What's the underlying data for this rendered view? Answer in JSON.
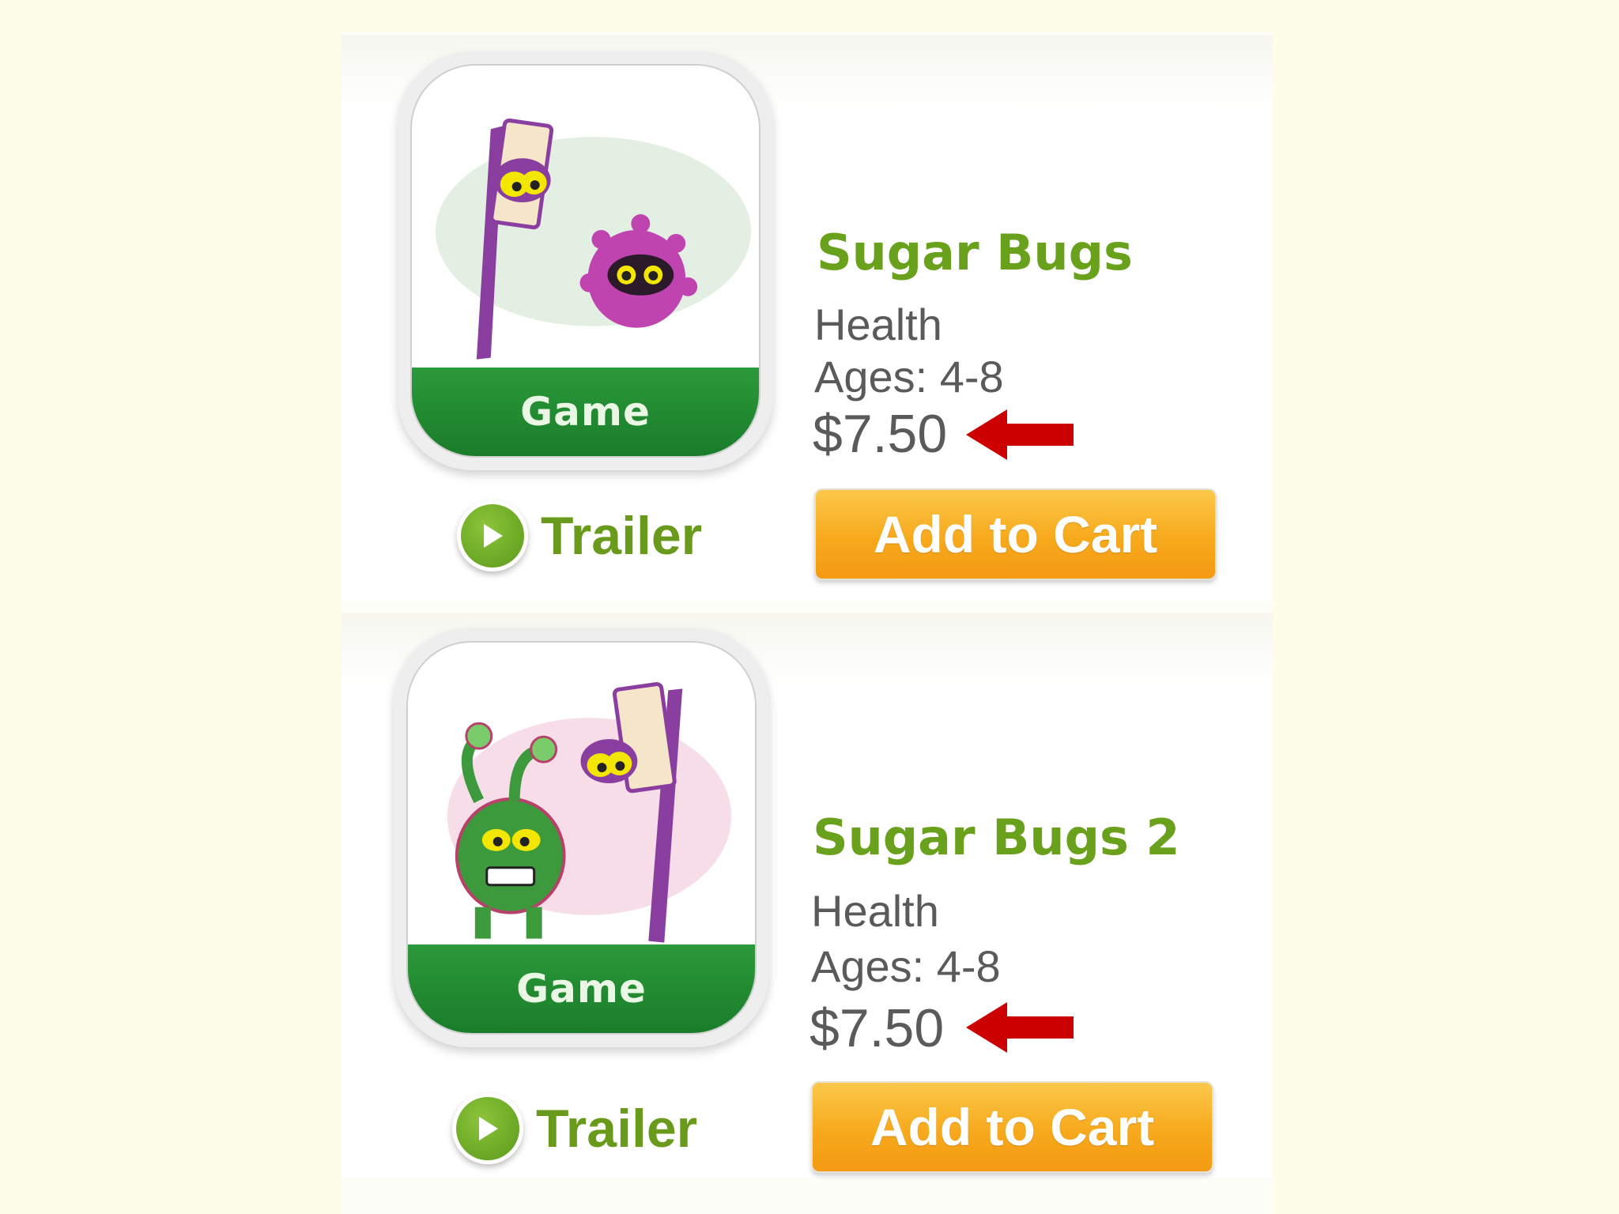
{
  "products": [
    {
      "title": "Sugar Bugs",
      "category": "Health",
      "ages": "Ages: 4-8",
      "price": "$7.50",
      "badge": "Game",
      "trailer_label": "Trailer",
      "cart_label": "Add to Cart"
    },
    {
      "title": "Sugar Bugs 2",
      "category": "Health",
      "ages": "Ages: 4-8",
      "price": "$7.50",
      "badge": "Game",
      "trailer_label": "Trailer",
      "cart_label": "Add to Cart"
    }
  ],
  "colors": {
    "title_green": "#6aa11c",
    "band_green": "#1f8a2f",
    "button_orange": "#f7a91c",
    "arrow_red": "#cc0000",
    "background": "#fdfde9"
  },
  "icons": [
    "play-icon",
    "red-arrow-icon",
    "toothbrush-character",
    "sugar-bug-character"
  ]
}
